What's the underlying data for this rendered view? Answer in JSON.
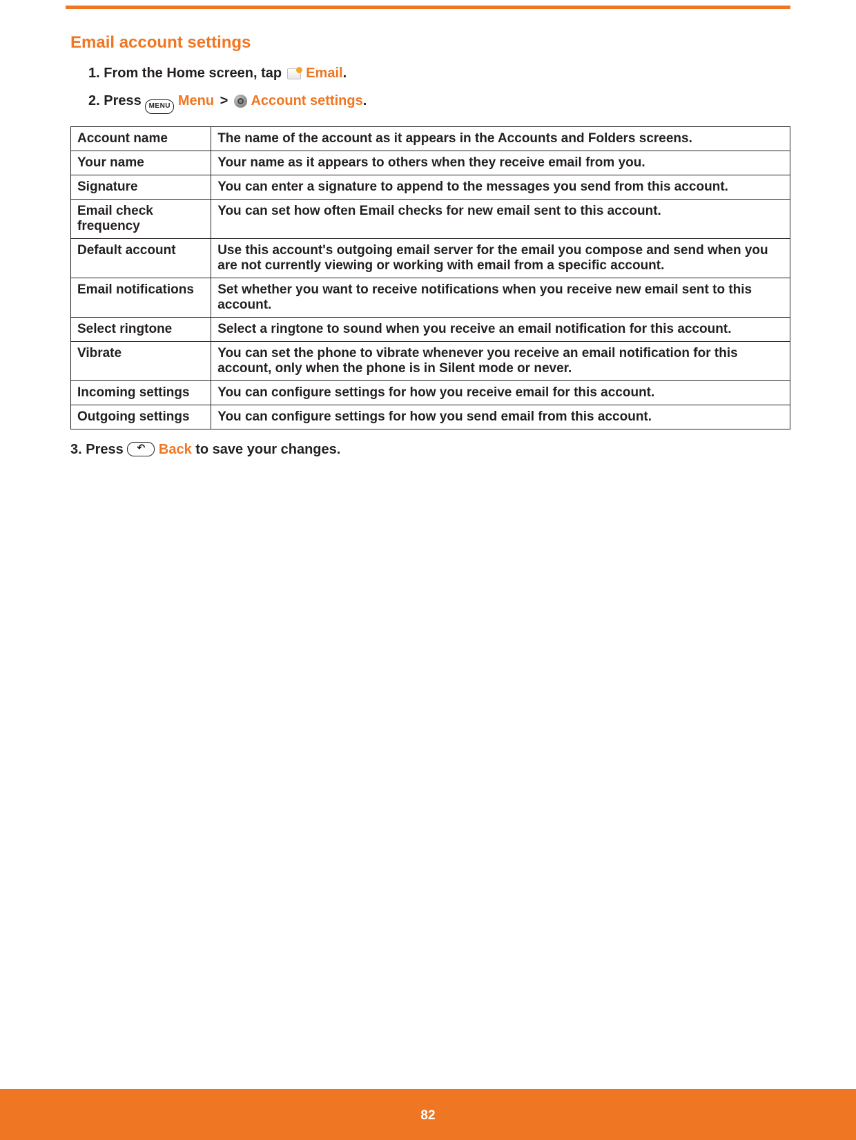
{
  "heading": "Email account settings",
  "step1": {
    "num": "1.",
    "text_a": "From the Home screen, tap ",
    "accent": "Email",
    "text_b": "."
  },
  "step2": {
    "num": "2.",
    "text_a": "Press ",
    "menu_btn": "MENU",
    "accent_a": "Menu",
    "gt": ">",
    "accent_b": "Account settings",
    "text_b": "."
  },
  "table": [
    {
      "k": "Account name",
      "v": "The name of the account as it appears in the Accounts and Folders screens."
    },
    {
      "k": "Your name",
      "v": "Your name as it appears to others when they receive email from you."
    },
    {
      "k": "Signature",
      "v": "You can enter a signature to append to the messages you send from this account."
    },
    {
      "k": "Email check frequency",
      "v": "You can set how often Email checks for new email sent to this account."
    },
    {
      "k": "Default account",
      "v": "Use this account's outgoing email server for the email you compose and send when you are not currently viewing or working with email from a specific account."
    },
    {
      "k": "Email notifications",
      "v": "Set whether you want to receive notifications when you receive new email sent to this account."
    },
    {
      "k": "Select ringtone",
      "v": "Select a ringtone to sound when you receive an email notification for this account."
    },
    {
      "k": "Vibrate",
      "v": "You can set the phone to vibrate whenever you receive an email notification for this account, only when the phone is in Silent mode or never."
    },
    {
      "k": "Incoming settings",
      "v": "You can configure settings for how you receive email for this account."
    },
    {
      "k": "Outgoing settings",
      "v": "You can configure settings for how you send email from this account."
    }
  ],
  "step3": {
    "num": "3.",
    "text_a": "Press ",
    "accent": "Back",
    "text_b": " to save your changes."
  },
  "page_num": "82"
}
